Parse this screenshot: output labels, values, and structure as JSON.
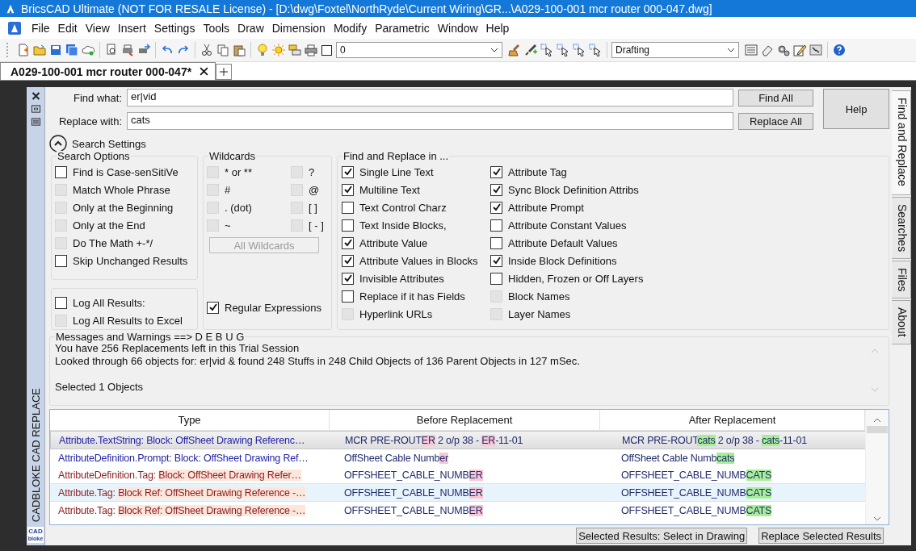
{
  "window": {
    "title": "BricsCAD Ultimate (NOT FOR RESALE License) - [D:\\dwg\\Foxtel\\NorthRyde\\Current Wiring\\GR...\\A029-100-001 mcr router 000-047.dwg]"
  },
  "menu": [
    {
      "label": "File"
    },
    {
      "label": "Edit"
    },
    {
      "label": "View"
    },
    {
      "label": "Insert"
    },
    {
      "label": "Settings"
    },
    {
      "label": "Tools"
    },
    {
      "label": "Draw"
    },
    {
      "label": "Dimension"
    },
    {
      "label": "Modify"
    },
    {
      "label": "Parametric"
    },
    {
      "label": "Window"
    },
    {
      "label": "Help"
    }
  ],
  "toolbar": {
    "layer": "0",
    "workspace": "Drafting"
  },
  "document_tabs": [
    {
      "label": "A029-100-001 mcr router 000-047*",
      "selected": true
    }
  ],
  "side_strip": {
    "title": "CADBLOKE CAD REPLACE",
    "logo": [
      "CAD",
      "bloke"
    ]
  },
  "side_tabs": [
    {
      "label": "Find and Replace",
      "selected": true
    },
    {
      "label": "Searches",
      "selected": false
    },
    {
      "label": "Files",
      "selected": false
    },
    {
      "label": "About",
      "selected": false
    }
  ],
  "find": {
    "label": "Find what:",
    "value": "er|vid"
  },
  "replace": {
    "label": "Replace with:",
    "value": "cats"
  },
  "buttons": {
    "find_all": "Find All",
    "replace_all": "Replace All",
    "help": "Help"
  },
  "settings_toggle": {
    "label": "Search Settings",
    "expanded": true
  },
  "search_options": {
    "title": "Search Options",
    "items": [
      {
        "label": "Find is Case-senSitiVe",
        "checked": false,
        "disabled": false
      },
      {
        "label": "Match Whole Phrase",
        "checked": false,
        "disabled": true
      },
      {
        "label": "Only at the Beginning",
        "checked": false,
        "disabled": true
      },
      {
        "label": "Only at the End",
        "checked": false,
        "disabled": true
      },
      {
        "label": "Do The Math +-*/",
        "checked": false,
        "disabled": true
      },
      {
        "label": "Skip Unchanged Results",
        "checked": false,
        "disabled": false
      }
    ]
  },
  "log_options": {
    "items": [
      {
        "label": "Log All Results:",
        "checked": false,
        "disabled": false
      },
      {
        "label": "Log All Results to Excel",
        "checked": false,
        "disabled": true
      }
    ]
  },
  "wildcards": {
    "title": "Wildcards",
    "items": [
      {
        "label": "* or **",
        "checked": false,
        "disabled": true
      },
      {
        "label": "#",
        "checked": false,
        "disabled": true
      },
      {
        "label": ". (dot)",
        "checked": false,
        "disabled": true
      },
      {
        "label": "~",
        "checked": false,
        "disabled": true
      },
      {
        "label": "?",
        "checked": false,
        "disabled": true
      },
      {
        "label": "@",
        "checked": false,
        "disabled": true
      },
      {
        "label": "[ ]",
        "checked": false,
        "disabled": true
      },
      {
        "label": "[ - ]",
        "checked": false,
        "disabled": true
      }
    ],
    "all_button": {
      "label": "All Wildcards",
      "disabled": true
    },
    "regex": {
      "label": "Regular Expressions",
      "checked": true,
      "disabled": false
    }
  },
  "find_in": {
    "title": "Find and Replace in ...",
    "items": [
      {
        "label": "Single Line Text",
        "checked": true,
        "disabled": false
      },
      {
        "label": "Multiline Text",
        "checked": true,
        "disabled": false
      },
      {
        "label": "Text Control Charz",
        "checked": false,
        "disabled": false
      },
      {
        "label": "Text Inside Blocks,",
        "checked": false,
        "disabled": false
      },
      {
        "label": "Attribute Value",
        "checked": true,
        "disabled": false
      },
      {
        "label": "Attribute Values in Blocks",
        "checked": true,
        "disabled": false
      },
      {
        "label": "Invisible Attributes",
        "checked": true,
        "disabled": false
      },
      {
        "label": "Replace if it has Fields",
        "checked": false,
        "disabled": false
      },
      {
        "label": "Hyperlink URLs",
        "checked": false,
        "disabled": true
      },
      {
        "label": "Attribute Tag",
        "checked": true,
        "disabled": false
      },
      {
        "label": "Sync Block Definition Attribs",
        "checked": true,
        "disabled": false
      },
      {
        "label": "Attribute Prompt",
        "checked": true,
        "disabled": false
      },
      {
        "label": "Attribute Constant Values",
        "checked": false,
        "disabled": false
      },
      {
        "label": "Attribute Default Values",
        "checked": false,
        "disabled": false
      },
      {
        "label": "Inside Block Definitions",
        "checked": true,
        "disabled": false
      },
      {
        "label": "Hidden, Frozen or Off Layers",
        "checked": false,
        "disabled": false
      },
      {
        "label": "Block Names",
        "checked": false,
        "disabled": true
      },
      {
        "label": "Layer Names",
        "checked": false,
        "disabled": true
      }
    ]
  },
  "messages": {
    "title": "Messages and Warnings  ==> D E B U G",
    "lines": [
      "You have 256 Replacements left in this Trial Session",
      "Looked through 66 objects for: er|vid & found 248 Stuffs in 248 Child Objects of 136 Parent Objects in 127 mSec."
    ],
    "status": "Selected 1 Objects"
  },
  "table": {
    "columns": [
      "Type",
      "Before Replacement",
      "After Replacement"
    ],
    "rows": [
      {
        "selected": true,
        "hover": false,
        "color": "#1f1fa6",
        "type": [
          {
            "text": "Attribute.TextString: Block: OffSheet Drawing Referenc…",
            "match": false
          }
        ],
        "before": [
          {
            "text": "MCR PRE-ROUT",
            "match": false
          },
          {
            "text": "ER",
            "match": true
          },
          {
            "text": " 2 o/p 38 - ",
            "match": false
          },
          {
            "text": "ER",
            "match": true
          },
          {
            "text": "-11-01",
            "match": false
          }
        ],
        "after": [
          {
            "text": "MCR PRE-ROUT",
            "match": false
          },
          {
            "text": "cats",
            "match": true
          },
          {
            "text": " 2 o/p 38 - ",
            "match": false
          },
          {
            "text": "cats",
            "match": true
          },
          {
            "text": "-11-01",
            "match": false
          }
        ]
      },
      {
        "selected": false,
        "hover": false,
        "color": "#1f1fa6",
        "type": [
          {
            "text": "AttributeDefinition.Prompt: Block: OffSheet Drawing Ref…",
            "match": false
          }
        ],
        "before": [
          {
            "text": "OffSheet Cable Numb",
            "match": false
          },
          {
            "text": "er",
            "match": true
          }
        ],
        "after": [
          {
            "text": "OffSheet Cable Numb",
            "match": false
          },
          {
            "text": "cats",
            "match": true
          }
        ]
      },
      {
        "selected": false,
        "hover": false,
        "color": "#8b1c1c",
        "type": [
          {
            "text": "AttributeDefinition.Tag: ",
            "match": false
          },
          {
            "text": "Block: OffSheet Drawing Refer…",
            "match": true
          }
        ],
        "before": [
          {
            "text": "OFFSHEET_CABLE_NUMB",
            "match": false
          },
          {
            "text": "ER",
            "match": true
          }
        ],
        "after": [
          {
            "text": "OFFSHEET_CABLE_NUMB",
            "match": false
          },
          {
            "text": "CATS",
            "match": true
          }
        ]
      },
      {
        "selected": false,
        "hover": true,
        "color": "#8b1c1c",
        "type": [
          {
            "text": "Attribute.Tag: ",
            "match": false
          },
          {
            "text": "Block Ref: OffSheet Drawing Reference -…",
            "match": true
          }
        ],
        "before": [
          {
            "text": "OFFSHEET_CABLE_NUMB",
            "match": false
          },
          {
            "text": "ER",
            "match": true
          }
        ],
        "after": [
          {
            "text": "OFFSHEET_CABLE_NUMB",
            "match": false
          },
          {
            "text": "CATS",
            "match": true
          }
        ]
      },
      {
        "selected": false,
        "hover": false,
        "color": "#8b1c1c",
        "type": [
          {
            "text": "Attribute.Tag: ",
            "match": false
          },
          {
            "text": "Block Ref: OffSheet Drawing Reference -…",
            "match": true
          }
        ],
        "before": [
          {
            "text": "OFFSHEET_CABLE_NUMB",
            "match": false
          },
          {
            "text": "ER",
            "match": true
          }
        ],
        "after": [
          {
            "text": "OFFSHEET_CABLE_NUMB",
            "match": false
          },
          {
            "text": "CATS",
            "match": true
          }
        ]
      }
    ]
  },
  "actions": [
    "Selected Results: Select in Drawing",
    "Replace Selected Results"
  ]
}
